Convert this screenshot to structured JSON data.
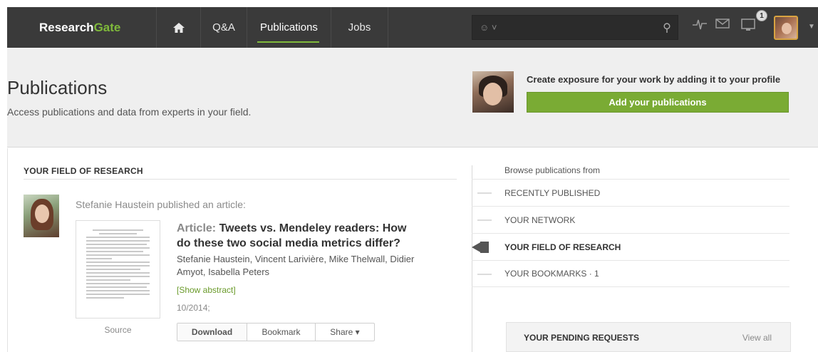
{
  "nav": {
    "logo_research": "Research",
    "logo_gate": "Gate",
    "items": [
      {
        "label": "Q&A"
      },
      {
        "label": "Publications"
      },
      {
        "label": "Jobs"
      }
    ],
    "search": {
      "placeholder": ""
    },
    "notification_count": "1",
    "accent_color": "#7fb93b"
  },
  "header": {
    "title": "Publications",
    "subtitle": "Access publications and data from experts in your field.",
    "promo_text": "Create exposure for your work by adding it to your profile",
    "promo_button": "Add your publications"
  },
  "feed": {
    "section_title": "YOUR FIELD OF RESEARCH",
    "published_line": "Stefanie Haustein published an article:",
    "article": {
      "kind": "Article:",
      "title": "Tweets vs. Mendeley readers: How do these two social media metrics differ?",
      "authors": "Stefanie Haustein, Vincent Larivière, Mike Thelwall, Didier Amyot, Isabella Peters",
      "show_abstract": "[Show abstract]",
      "date": "10/2014;",
      "source_label": "Source"
    },
    "actions": {
      "download": "Download",
      "bookmark": "Bookmark",
      "share": "Share ▾"
    }
  },
  "browse": {
    "heading": "Browse publications from",
    "items": [
      {
        "label": "RECENTLY PUBLISHED"
      },
      {
        "label": "YOUR NETWORK"
      },
      {
        "label": "YOUR FIELD OF RESEARCH"
      },
      {
        "label": "YOUR BOOKMARKS · 1"
      }
    ]
  },
  "pending": {
    "title": "YOUR PENDING REQUESTS",
    "link": "View all"
  }
}
